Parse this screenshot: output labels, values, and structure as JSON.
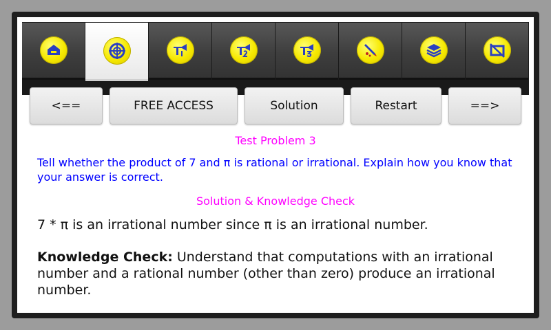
{
  "tabs": [
    {
      "icon": "home-icon"
    },
    {
      "icon": "target-icon"
    },
    {
      "icon": "trumpet-1-icon"
    },
    {
      "icon": "trumpet-2-icon"
    },
    {
      "icon": "trumpet-3-icon"
    },
    {
      "icon": "pencil-eraser-icon"
    },
    {
      "icon": "layers-icon"
    },
    {
      "icon": "slash-box-icon"
    }
  ],
  "active_tab": 1,
  "buttons": {
    "prev": "<==",
    "free_access": "FREE ACCESS",
    "solution": "Solution",
    "restart": "Restart",
    "next": "==>"
  },
  "content": {
    "title": "Test Problem 3",
    "problem": "Tell whether the product of 7 and π is rational or irrational. Explain how you know that your answer is correct.",
    "solution_title": "Solution & Knowledge Check",
    "answer": "7 * π is an irrational number since π is an irrational number.",
    "knowledge_label": "Knowledge Check:",
    "knowledge_text": " Understand that computations with an irrational number and a rational number (other than zero) produce an irrational number."
  },
  "colors": {
    "title": "#ff00ff",
    "problem": "#0000ff",
    "badge": "#f6e800",
    "icon": "#2a3fc0"
  }
}
